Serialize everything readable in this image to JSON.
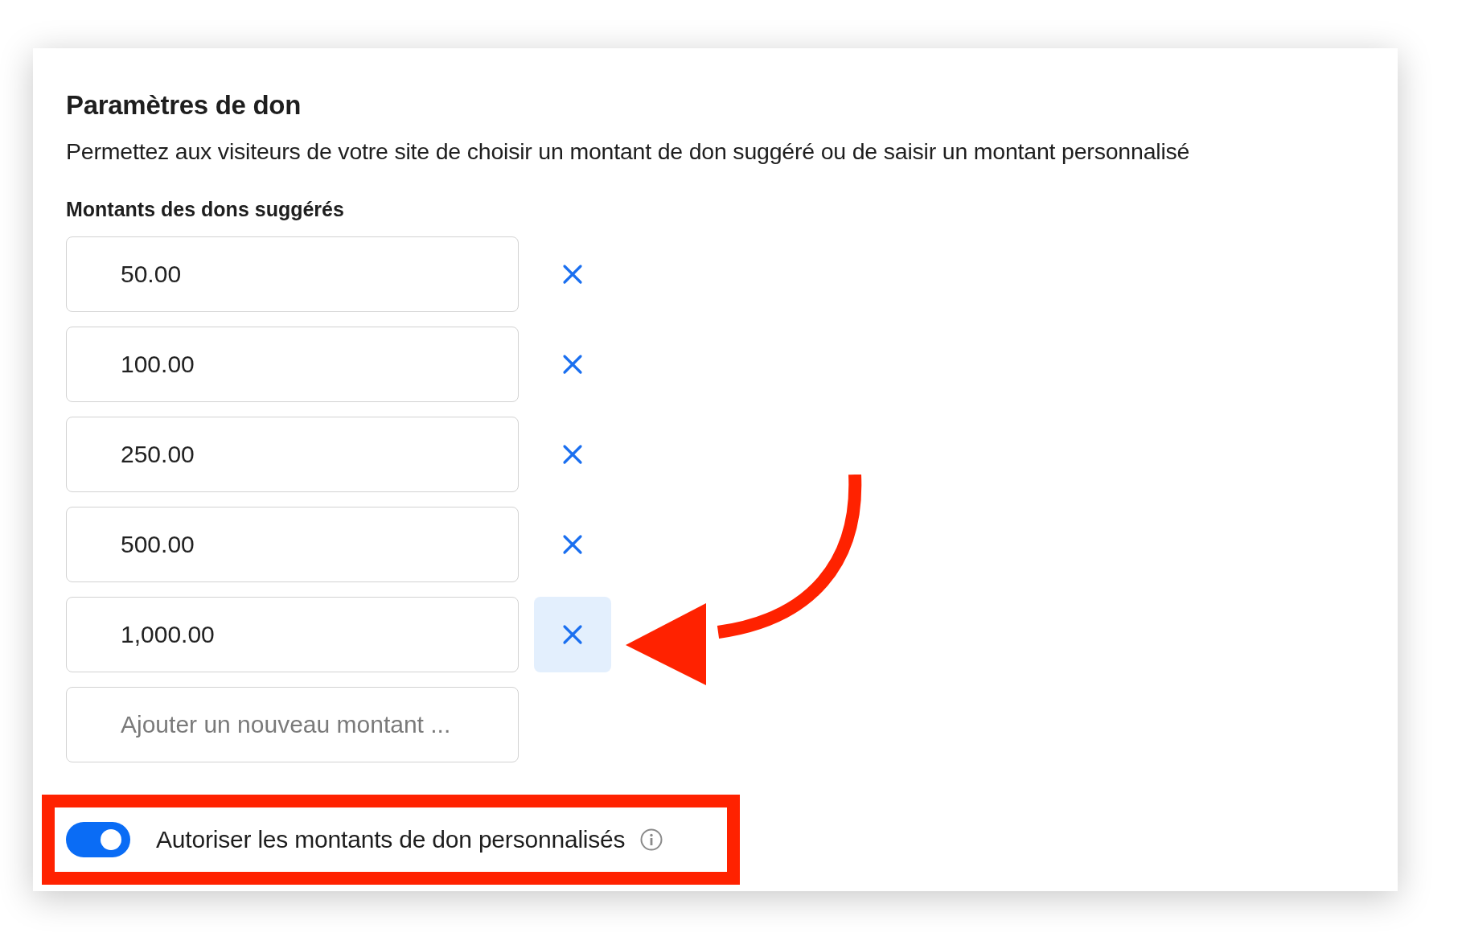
{
  "title": "Paramètres de don",
  "description": "Permettez aux visiteurs de votre site de choisir un montant de don suggéré ou de saisir un montant personnalisé",
  "amounts_label": "Montants des dons suggérés",
  "amounts": [
    {
      "value": "50.00",
      "remove_highlighted": false
    },
    {
      "value": "100.00",
      "remove_highlighted": false
    },
    {
      "value": "250.00",
      "remove_highlighted": false
    },
    {
      "value": "500.00",
      "remove_highlighted": false
    },
    {
      "value": "1,000.00",
      "remove_highlighted": true
    }
  ],
  "new_amount": {
    "placeholder": "Ajouter un nouveau montant ..."
  },
  "custom_amounts": {
    "label": "Autoriser les montants de don personnalisés",
    "on": true
  }
}
